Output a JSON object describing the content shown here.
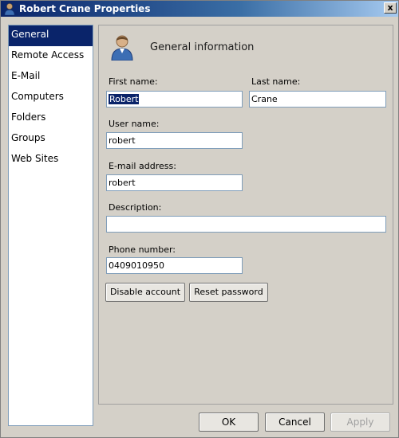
{
  "window": {
    "title": "Robert Crane  Properties",
    "close_label": "x"
  },
  "sidebar": {
    "items": [
      {
        "label": "General",
        "selected": true
      },
      {
        "label": "Remote Access"
      },
      {
        "label": "E-Mail"
      },
      {
        "label": "Computers"
      },
      {
        "label": "Folders"
      },
      {
        "label": "Groups"
      },
      {
        "label": "Web Sites"
      }
    ]
  },
  "panel": {
    "title": "General information",
    "fields": {
      "first_name": {
        "label": "First name:",
        "value": "Robert"
      },
      "last_name": {
        "label": "Last name:",
        "value": "Crane"
      },
      "user_name": {
        "label": "User name:",
        "value": "robert"
      },
      "email": {
        "label": "E-mail address:",
        "value": "robert"
      },
      "description": {
        "label": "Description:",
        "value": ""
      },
      "phone": {
        "label": "Phone number:",
        "value": "0409010950"
      }
    },
    "buttons": {
      "disable_account": "Disable account",
      "reset_password": "Reset password"
    }
  },
  "dialog_buttons": {
    "ok": "OK",
    "cancel": "Cancel",
    "apply": "Apply"
  },
  "colors": {
    "titlebar_start": "#0a246a",
    "selection": "#0a246a",
    "window_bg": "#d4d0c8"
  },
  "icons": {
    "app": "user-icon",
    "header": "user-icon",
    "close": "close-icon"
  }
}
